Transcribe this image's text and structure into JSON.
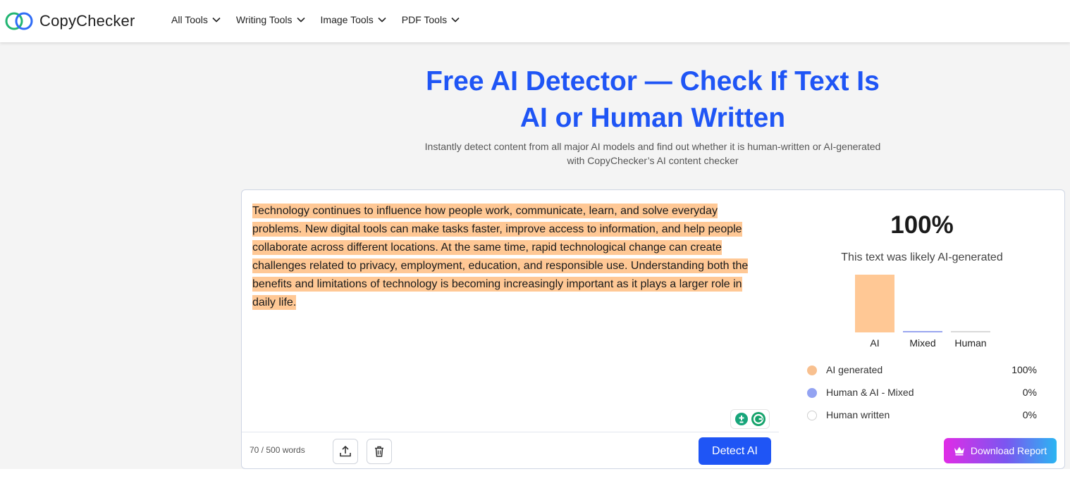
{
  "brand": {
    "name": "CopyChecker",
    "logo_icon": "interlocking-rings-icon"
  },
  "nav": {
    "items": [
      {
        "label": "All Tools"
      },
      {
        "label": "Writing Tools"
      },
      {
        "label": "Image Tools"
      },
      {
        "label": "PDF Tools"
      }
    ]
  },
  "hero": {
    "title_line1": "Free AI Detector — Check If Text Is",
    "title_line2": "AI or Human Written",
    "subtitle": "Instantly detect content from all major AI models and find out whether it is human-written or AI-generated with CopyChecker’s AI content checker"
  },
  "editor": {
    "text": "Technology continues to influence how people work, communicate, learn, and solve everyday problems. New digital tools can make tasks faster, improve access to information, and help people collaborate across different locations. At the same time, rapid technological change can create challenges related to privacy, employment, education, and responsible use. Understanding both the benefits and limitations of technology is becoming increasingly important as it plays a larger role in daily life.",
    "highlight_color": "#ffc895",
    "word_count": "70 / 500 words",
    "detect_label": "Detect AI"
  },
  "result": {
    "score": "100%",
    "verdict": "This text was likely AI-generated",
    "chart_data": {
      "type": "bar",
      "categories": [
        "AI",
        "Mixed",
        "Human"
      ],
      "values": [
        100,
        0,
        0
      ],
      "colors": [
        "#ffc895",
        "#9aa6ef",
        "#d9d9d9"
      ],
      "ylim": [
        0,
        100
      ]
    },
    "legend": [
      {
        "label": "AI generated",
        "value": "100%",
        "color": "#f8c08f"
      },
      {
        "label": "Human & AI - Mixed",
        "value": "0%",
        "color": "#93a3f2"
      },
      {
        "label": "Human written",
        "value": "0%",
        "color": "#ffffff"
      }
    ],
    "download_label": "Download Report"
  }
}
